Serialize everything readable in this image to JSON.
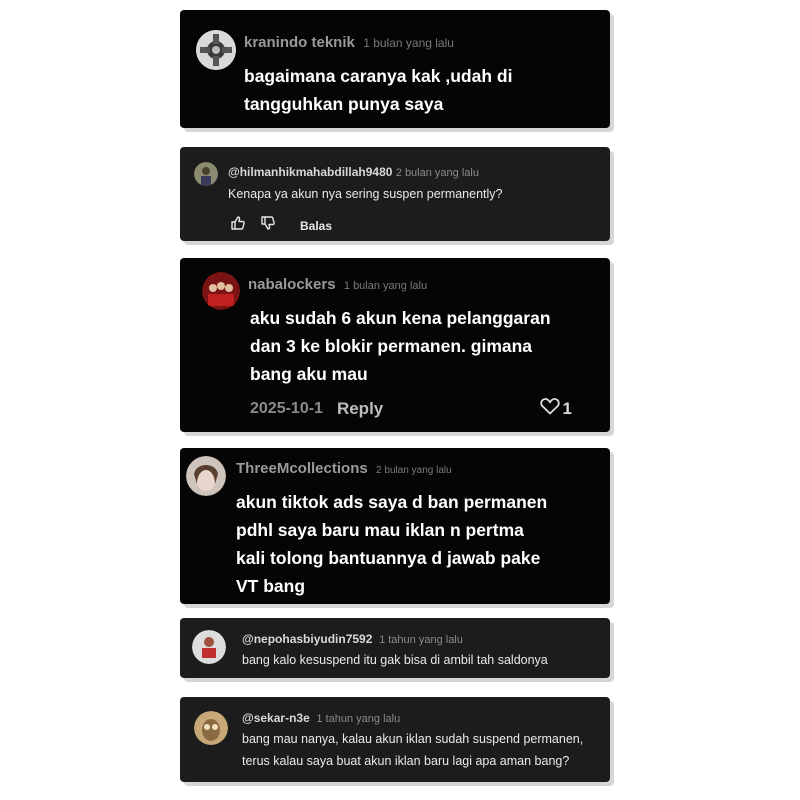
{
  "comments": [
    {
      "username": "kranindo teknik",
      "time": "1 bulan yang lalu",
      "lines": [
        "bagaimana caranya kak ,udah di",
        "tangguhkan punya saya"
      ]
    },
    {
      "username": "@hilmanhikmahabdillah9480",
      "time": "2 bulan yang lalu",
      "lines": [
        "Kenapa ya akun nya sering suspen permanently?"
      ],
      "actions": {
        "reply_label": "Balas"
      }
    },
    {
      "username": "nabalockers",
      "time": "1 bulan yang lalu",
      "lines": [
        "aku sudah 6 akun kena pelanggaran",
        "dan 3 ke blokir permanen. gimana",
        "bang aku mau"
      ],
      "footer": {
        "date": "2025-10-1",
        "reply_label": "Reply",
        "likes": "1"
      }
    },
    {
      "username": "ThreeMcollections",
      "time": "2 bulan yang lalu",
      "lines": [
        "akun tiktok ads saya d ban permanen",
        "pdhl saya baru mau iklan n pertma",
        "kali tolong bantuannya d jawab pake",
        "VT bang"
      ]
    },
    {
      "username": "@nepohasbiyudin7592",
      "time": "1 tahun yang lalu",
      "lines": [
        "bang kalo kesuspend itu gak bisa di ambil tah saldonya"
      ]
    },
    {
      "username": "@sekar-n3e",
      "time": "1 tahun yang lalu",
      "lines": [
        "bang mau nanya, kalau akun iklan sudah suspend permanen,",
        "terus kalau saya buat akun iklan baru lagi apa aman bang?"
      ]
    }
  ],
  "icons": {
    "like": "thumbs-up-icon",
    "dislike": "thumbs-down-icon",
    "heart": "heart-icon"
  }
}
